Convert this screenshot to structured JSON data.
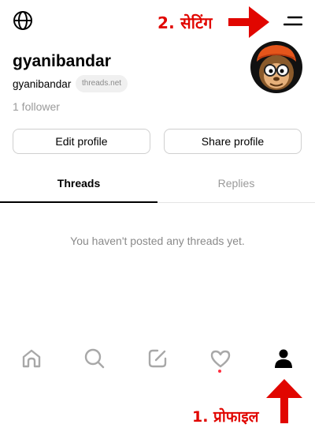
{
  "annotations": {
    "settings": "2. सेटिंग",
    "profile": "1. प्रोफाइल",
    "color": "#e10600"
  },
  "header": {
    "globe_icon": "globe-icon",
    "menu_icon": "menu-icon"
  },
  "profile": {
    "username": "gyanibandar",
    "handle": "gyanibandar",
    "domain_badge": "threads.net",
    "followers": "1 follower",
    "avatar_icon": "monkey-avatar"
  },
  "buttons": {
    "edit": "Edit profile",
    "share": "Share profile"
  },
  "tabs": [
    {
      "label": "Threads",
      "active": true
    },
    {
      "label": "Replies",
      "active": false
    }
  ],
  "empty_state": "You haven't posted any threads yet.",
  "bottom_nav": [
    {
      "icon": "home-icon",
      "active": false
    },
    {
      "icon": "search-icon",
      "active": false
    },
    {
      "icon": "compose-icon",
      "active": false
    },
    {
      "icon": "heart-icon",
      "active": false,
      "has_notification": true
    },
    {
      "icon": "profile-icon",
      "active": true
    }
  ]
}
